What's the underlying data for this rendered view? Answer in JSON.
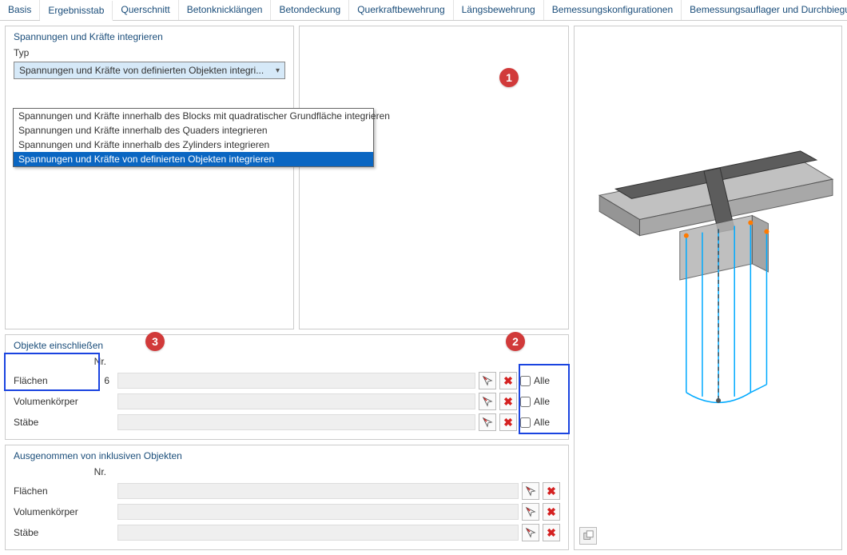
{
  "tabs": [
    "Basis",
    "Ergebnisstab",
    "Querschnitt",
    "Betonknicklängen",
    "Betondeckung",
    "Querkraftbewehrung",
    "Längsbewehrung",
    "Bemessungskonfigurationen",
    "Bemessungsauflager und Durchbiegung"
  ],
  "active_tab_index": 1,
  "panel_integrate": {
    "title": "Spannungen und Kräfte integrieren",
    "label_type": "Typ",
    "selected": "Spannungen und Kräfte von definierten Objekten integri...",
    "options": [
      "Spannungen und Kräfte innerhalb des Blocks mit quadratischer Grundfläche integrieren",
      "Spannungen und Kräfte innerhalb des Quaders integrieren",
      "Spannungen und Kräfte innerhalb des Zylinders integrieren",
      "Spannungen und Kräfte von definierten Objekten integrieren"
    ],
    "selected_index": 3
  },
  "badges": {
    "b1": "1",
    "b2": "2",
    "b3": "3"
  },
  "include": {
    "title": "Objekte einschließen",
    "col_nr": "Nr.",
    "row_flaechen": {
      "label": "Flächen",
      "nr": "6",
      "alle": "Alle"
    },
    "row_volumen": {
      "label": "Volumenkörper",
      "nr": "",
      "alle": "Alle"
    },
    "row_staebe": {
      "label": "Stäbe",
      "nr": "",
      "alle": "Alle"
    }
  },
  "exclude": {
    "title": "Ausgenommen von inklusiven Objekten",
    "col_nr": "Nr.",
    "row_flaechen": {
      "label": "Flächen"
    },
    "row_volumen": {
      "label": "Volumenkörper"
    },
    "row_staebe": {
      "label": "Stäbe"
    }
  }
}
